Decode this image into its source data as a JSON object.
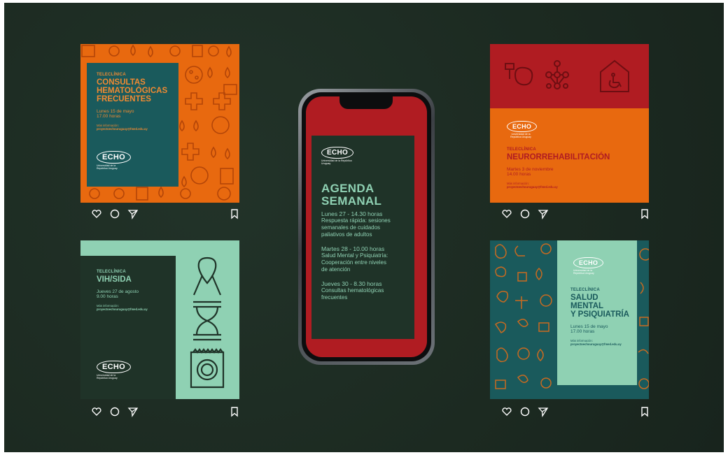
{
  "posts": {
    "hemato": {
      "kicker": "TELECLÍNICA",
      "title_lines": [
        "CONSULTAS",
        "HEMATOLÓGICAS",
        "FRECUENTES"
      ],
      "date": "Lunes 15 de mayo",
      "time": "17.00 horas",
      "info_label": "Más información:",
      "info_email": "proyectoechouruguay@fmed.edu.uy",
      "logo": "ECHO",
      "logo_sub": "Universidad de la República Uruguay"
    },
    "neuro": {
      "kicker": "TELECLÍNICA",
      "title": "NEURORREHABILITACIÓN",
      "date": "Martes 3 de noviembre",
      "time": "14.00 horas",
      "info_label": "Más información:",
      "info_email": "proyectoechouruguay@fmed.edu.uy",
      "logo": "ECHO",
      "logo_sub": "Universidad de la República Uruguay"
    },
    "vih": {
      "kicker": "TELECLÍNICA",
      "title": "VIH/SIDA",
      "date": "Jueves 27 de agosto",
      "time": "9.00 horas",
      "info_label": "Más información:",
      "info_email": "proyectoechouruguay@fmed.edu.uy",
      "logo": "ECHO",
      "logo_sub": "Universidad de la República Uruguay"
    },
    "salud": {
      "kicker": "TELECLÍNICA",
      "title_lines": [
        "SALUD",
        "MENTAL",
        "Y PSIQUIATRÍA"
      ],
      "date": "Lunes 15 de mayo",
      "time": "17.00 horas",
      "info_label": "Más información:",
      "info_email": "proyectoechouruguay@fmed.edu.uy",
      "logo": "ECHO",
      "logo_sub": "Universidad de la República Uruguay"
    }
  },
  "phone": {
    "logo": "ECHO",
    "logo_sub": "Universidad de la República Uruguay",
    "title_lines": [
      "AGENDA",
      "SEMANAL"
    ],
    "events": [
      {
        "when": "Lunes 27 - 14.30 horas",
        "desc": [
          "Respuesta rápida: sesiones",
          "semanales de cuidados",
          "paliativos de adultos"
        ]
      },
      {
        "when": "Martes 28 - 10.00 horas",
        "desc": [
          "Salud Mental y Psiquiatría:",
          "Cooperación entre niveles",
          "de atención"
        ]
      },
      {
        "when": "Jueves 30 - 8.30 horas",
        "desc": [
          "Consultas hematológicas",
          "frecuentes"
        ]
      }
    ]
  },
  "icons": {
    "like": "heart-icon",
    "comment": "comment-icon",
    "share": "send-icon",
    "save": "bookmark-icon"
  },
  "colors": {
    "background": "#1d2b22",
    "orange": "#e8690f",
    "teal": "#1a5a5c",
    "red": "#b01c22",
    "dark_green": "#1f3328",
    "mint": "#8fd1b3"
  }
}
